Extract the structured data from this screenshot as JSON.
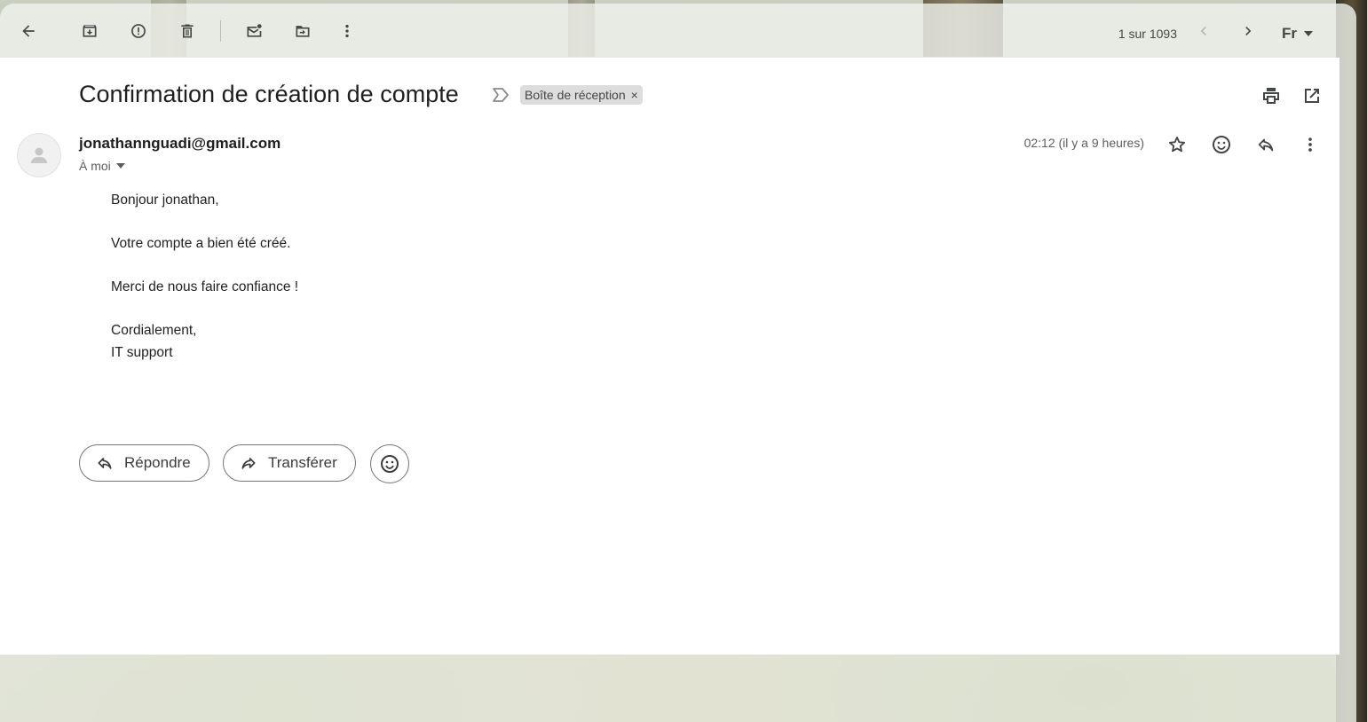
{
  "toolbar": {
    "back_icon": "arrow-left-icon",
    "archive_icon": "archive-icon",
    "spam_icon": "report-spam-icon",
    "delete_icon": "trash-icon",
    "mark_unread_icon": "mark-unread-icon",
    "move_icon": "move-to-icon",
    "more_icon": "more-vertical-icon",
    "pager_text": "1 sur 1093",
    "language_label": "Fr"
  },
  "email": {
    "subject": "Confirmation de création de compte",
    "label": "Boîte de réception",
    "label_remove": "×",
    "sender": "jonathannguadi@gmail.com",
    "recipient_label": "À moi",
    "timestamp": "02:12 (il y a 9 heures)",
    "body": {
      "greeting": "Bonjour jonathan,",
      "line1": "Votre compte a bien été créé.",
      "line2": "Merci de nous faire confiance !",
      "closing": "Cordialement,",
      "signature": "IT support"
    }
  },
  "actions": {
    "reply_label": "Répondre",
    "forward_label": "Transférer"
  },
  "colors": {
    "panel_bg": "#ffffff",
    "icon_gray": "#444746",
    "chip_bg": "#dddddd"
  }
}
